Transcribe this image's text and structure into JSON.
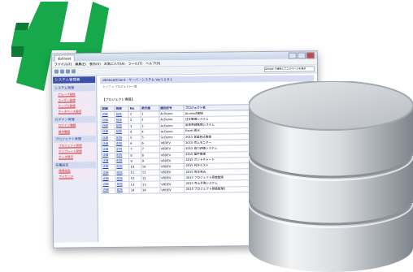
{
  "browser": {
    "tab_title": "dbSheet",
    "menu": [
      "ファイル(F)",
      "編集(E)",
      "表示(V)",
      "お気に入り(A)",
      "ツール(T)",
      "ヘルプ(H)"
    ],
    "search_placeholder": "Google で検索してこのページを表示"
  },
  "sidebar": {
    "title": "システム管理者",
    "groups": [
      {
        "label": "システム管理",
        "links": [
          "グループ登録",
          "ユーザー登録",
          "テーブル登録",
          "データベース接続"
        ]
      },
      {
        "label": "ログイン管理",
        "links": [
          "ログイン履歴",
          "操作履歴"
        ]
      },
      {
        "label": "プロジェクト管理",
        "links": [
          "プロジェクト登録",
          "テンプレート登録",
          "データ移行"
        ]
      },
      {
        "label": "各種設定",
        "links": [
          "環境設定",
          "ライセンス"
        ]
      }
    ]
  },
  "main": {
    "header": "dbSheetClient : サーバ・システム Ver1.2.8.1",
    "breadcrumb": "トップ > プロジェクト一覧",
    "section_title": "【プロジェクト情報】",
    "new_link": "新規追加",
    "columns": [
      "詳細",
      "削除",
      "No",
      "表示順",
      "識別記号",
      "プロジェクト名",
      "定義ファイル名"
    ],
    "rows": [
      [
        "詳細",
        "削除",
        "1",
        "1",
        "AcDemo",
        "AccessA管理",
        "dbS_AcDemo001.dbsP"
      ],
      [
        "詳細",
        "削除",
        "2",
        "2",
        "AcDemo",
        "注文管理システム",
        "dbS_AcDemo002.dbsP"
      ],
      [
        "詳細",
        "削除",
        "3",
        "3",
        "AcDemo",
        "出荷申請管理システム",
        "dbS_AcDemo003.dbsP"
      ],
      [
        "詳細",
        "削除",
        "4",
        "4",
        "AcDemo",
        "Excel 表示",
        "dbS_AcDemo004.dbsP"
      ],
      [
        "詳細",
        "削除",
        "5",
        "5",
        "ScDemo",
        "2015 営業見込管理",
        "dbS_ScDemo001.dbsP"
      ],
      [
        "詳細",
        "削除",
        "6",
        "6",
        "V8DEV",
        "2015 売上モニター",
        "dbS_V8DEV001.dbsP"
      ],
      [
        "詳細",
        "削除",
        "7",
        "7",
        "V8DEV",
        "2015 協力評価システム",
        "dbS_V8DEV002.dbsP"
      ],
      [
        "詳細",
        "削除",
        "8",
        "8",
        "V8DEV",
        "2015 案件管理",
        "dbS_V8DEV003.dbsP"
      ],
      [
        "詳細",
        "削除",
        "9",
        "9",
        "V8DEV",
        "2015 ガントチャート",
        "dbS_V8DEV004.dbsP"
      ],
      [
        "詳細",
        "削除",
        "10",
        "10",
        "V8DEV",
        "2015 PDFテスト",
        "dbS_V8DEV005.dbsP"
      ],
      [
        "詳細",
        "削除",
        "11",
        "11",
        "V8DEV",
        "2015 受注見込",
        "dbS_V8DEV006.dbsP"
      ],
      [
        "詳細",
        "削除",
        "12",
        "12",
        "V8DEV",
        "2015 プロジェクト原価管理",
        "dbS_V8DEV007.dbsP"
      ],
      [
        "詳細",
        "削除",
        "13",
        "13",
        "V8DEV",
        "2015 売上予測システム",
        "dbS_V8DEV008.dbsP"
      ],
      [
        "詳細",
        "削除",
        "14",
        "14",
        "V8DEV",
        "2015 プロジェクト原価管理2",
        "dbS_V8DEV009.dbsP"
      ]
    ]
  },
  "colors": {
    "logo_green": "#16a84a",
    "logo_dark": "#0d7a33",
    "sidebar_title": "#3b50a7"
  },
  "icons": [
    "database-icon",
    "app-logo-icon"
  ]
}
